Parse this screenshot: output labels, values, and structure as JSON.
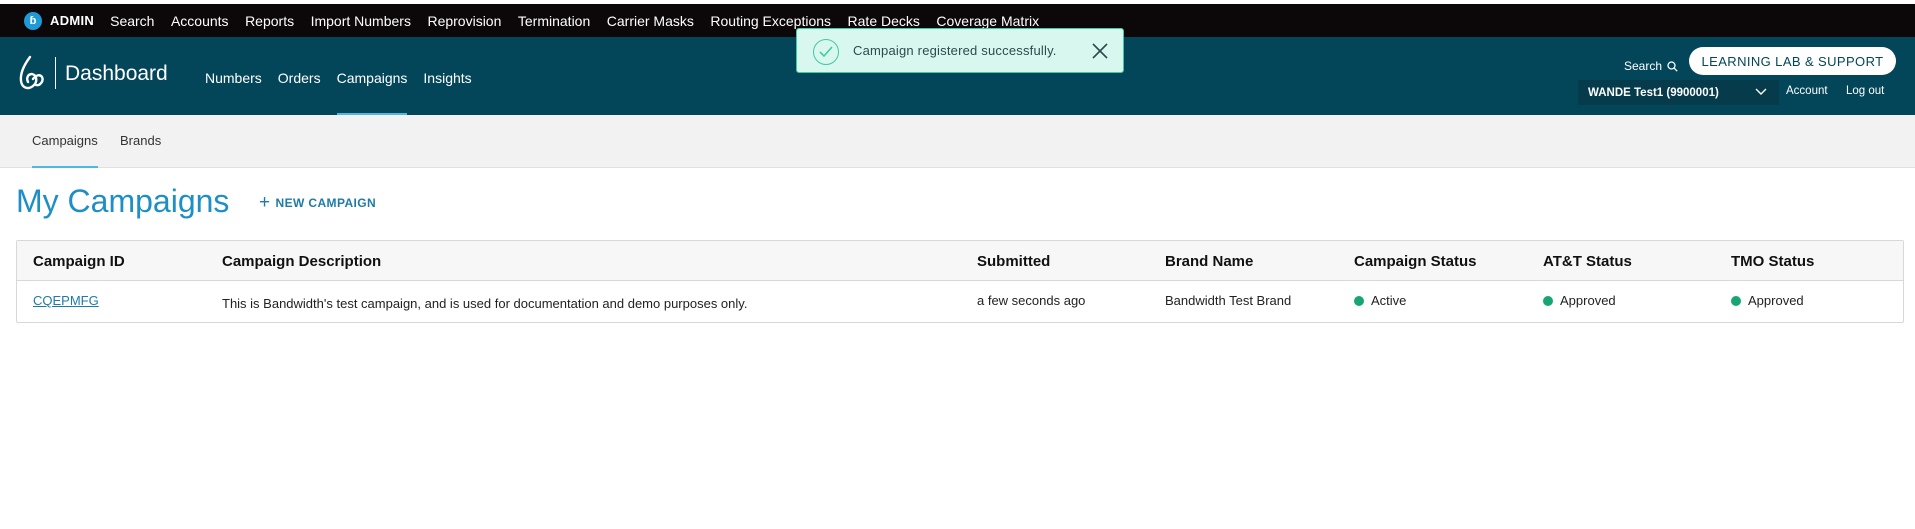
{
  "admin_bar": {
    "label": "ADMIN",
    "items": [
      "Search",
      "Accounts",
      "Reports",
      "Import Numbers",
      "Reprovision",
      "Termination",
      "Carrier Masks",
      "Routing Exceptions",
      "Rate Decks",
      "Coverage Matrix"
    ]
  },
  "header": {
    "title": "Dashboard",
    "nav": [
      "Numbers",
      "Orders",
      "Campaigns",
      "Insights"
    ],
    "active_nav": "Campaigns",
    "search_label": "Search",
    "support_button": "LEARNING LAB & SUPPORT",
    "account_selector": "WANDE Test1 (9900001)",
    "account_link": "Account",
    "logout_link": "Log out"
  },
  "toast": {
    "message": "Campaign registered successfully."
  },
  "sub_nav": {
    "items": [
      "Campaigns",
      "Brands"
    ],
    "active": "Campaigns"
  },
  "page": {
    "title": "My Campaigns",
    "new_campaign_label": "NEW CAMPAIGN"
  },
  "table": {
    "columns": [
      "Campaign ID",
      "Campaign Description",
      "Submitted",
      "Brand Name",
      "Campaign Status",
      "AT&T Status",
      "TMO Status"
    ],
    "rows": [
      {
        "campaign_id": "CQEPMFG",
        "description": "This is Bandwidth's test campaign, and is used for documentation and demo purposes only.",
        "submitted": "a few seconds ago",
        "brand_name": "Bandwidth Test Brand",
        "campaign_status": "Active",
        "att_status": "Approved",
        "tmo_status": "Approved"
      }
    ]
  },
  "colors": {
    "admin_bar": "#0c0708",
    "header": "#03465a",
    "accent": "#1e8fc6",
    "status_green": "#17a673",
    "toast_bg": "#d8f8ef"
  }
}
